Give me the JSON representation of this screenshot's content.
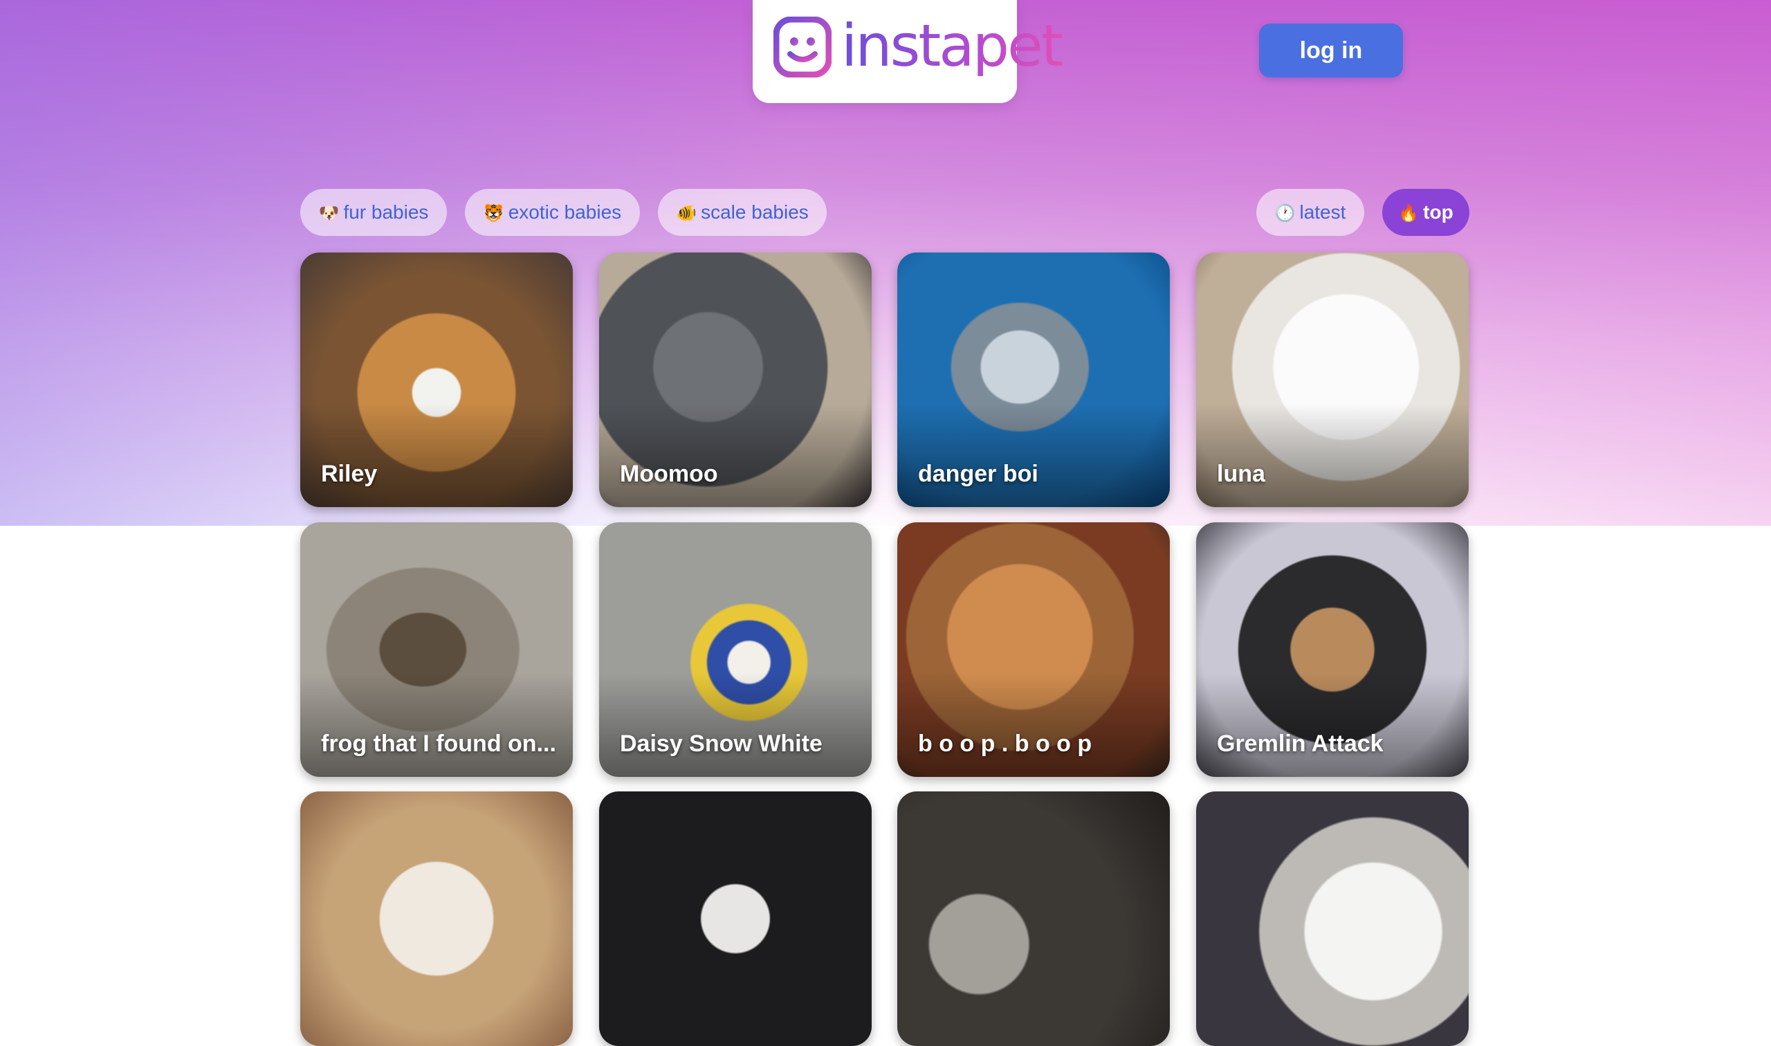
{
  "brand": {
    "name": "instapet",
    "colors": {
      "gradient_start": "#6c4fd6",
      "gradient_end": "#e04fb5"
    }
  },
  "header": {
    "login_label": "log in"
  },
  "categories": [
    {
      "emoji": "🐶",
      "label": "fur babies"
    },
    {
      "emoji": "🐯",
      "label": "exotic babies"
    },
    {
      "emoji": "🐠",
      "label": "scale babies"
    }
  ],
  "sort": [
    {
      "emoji": "🕐",
      "label": "latest",
      "active": false
    },
    {
      "emoji": "🔥",
      "label": "top",
      "active": true
    }
  ],
  "pets": [
    {
      "name": "Riley"
    },
    {
      "name": "Moomoo"
    },
    {
      "name": "danger boi"
    },
    {
      "name": "luna"
    },
    {
      "name": "frog that I found on..."
    },
    {
      "name": "Daisy Snow White"
    },
    {
      "name": "b o o p . b o o p"
    },
    {
      "name": "Gremlin Attack"
    },
    {
      "name": ""
    },
    {
      "name": ""
    },
    {
      "name": ""
    },
    {
      "name": ""
    }
  ],
  "accent_color": "#4a6fe0"
}
